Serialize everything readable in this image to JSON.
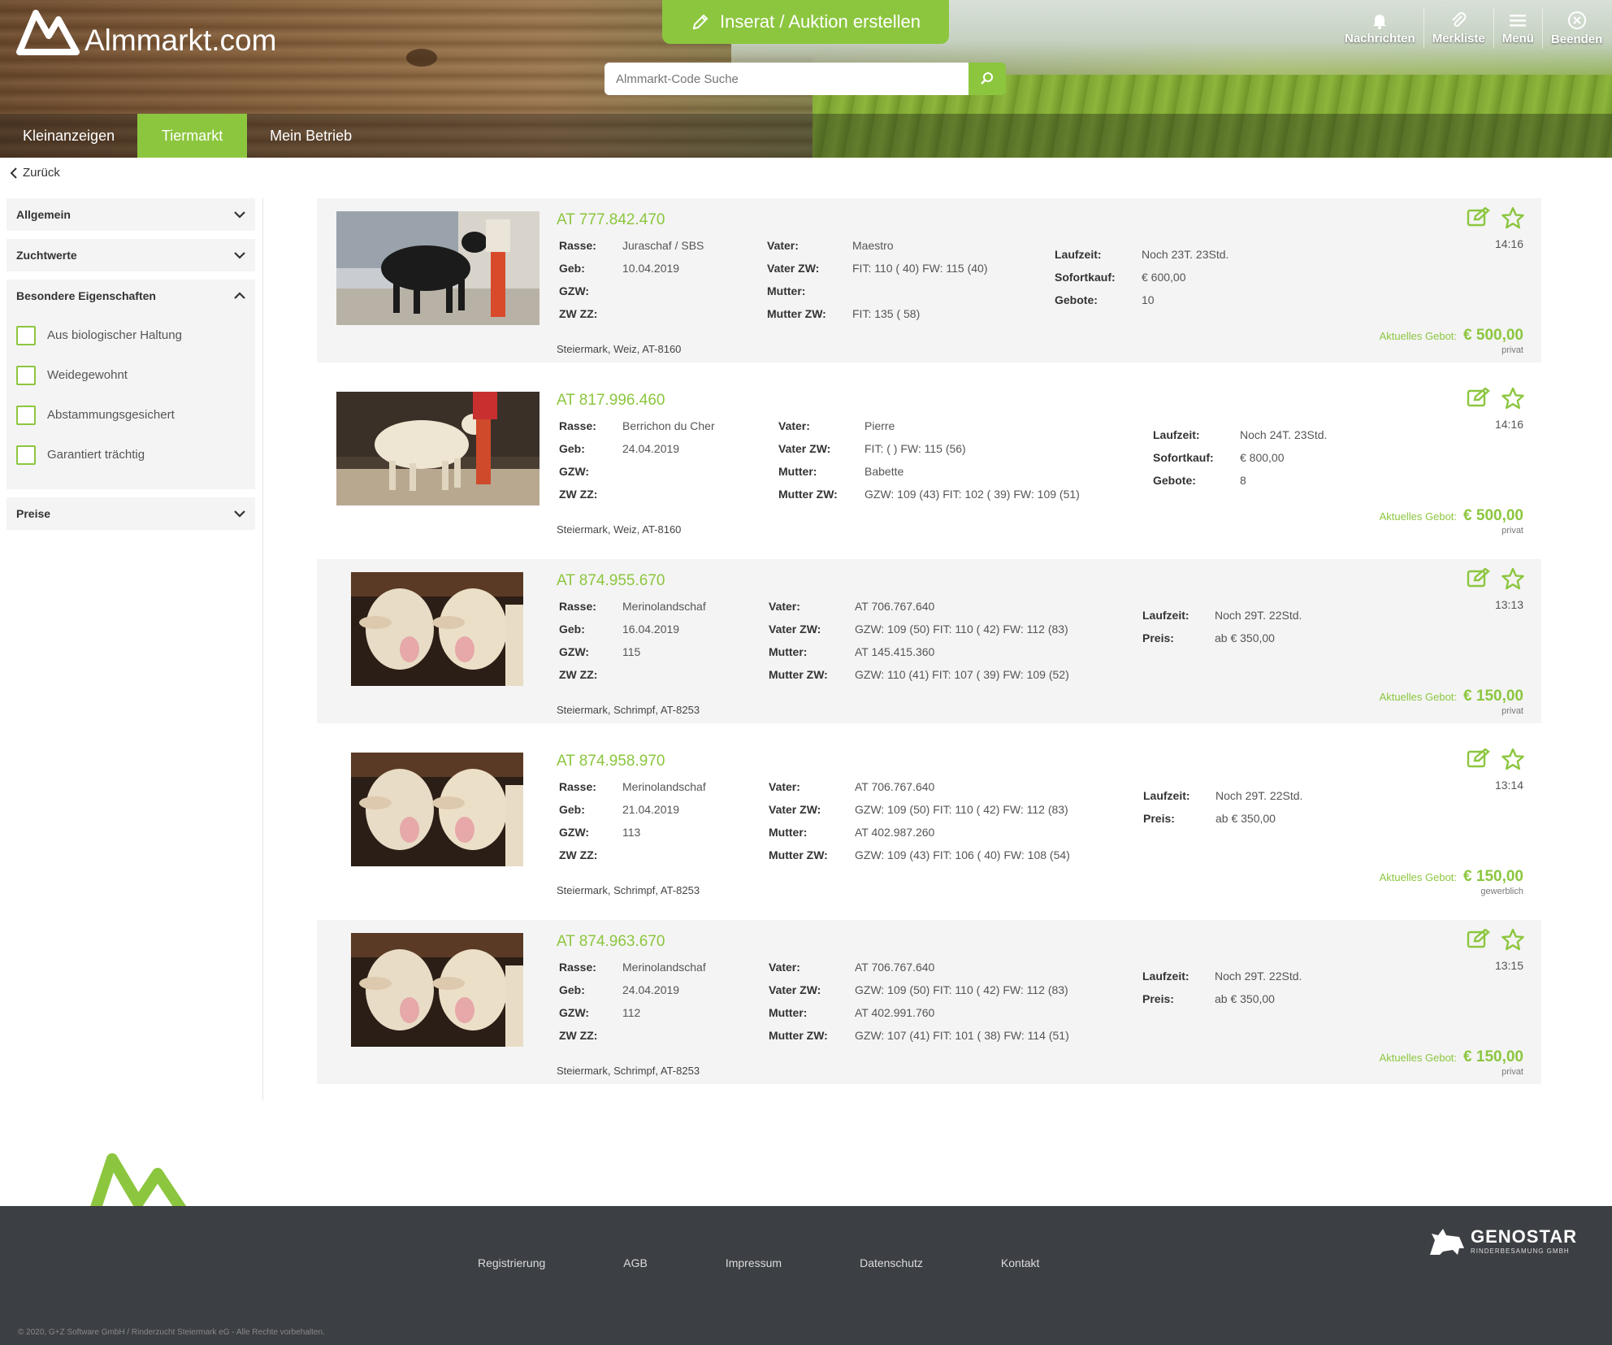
{
  "app": {
    "logo_text": "Almmarkt.com",
    "create_label": "Inserat / Auktion erstellen",
    "search_placeholder": "Almmarkt-Code Suche"
  },
  "topnav": [
    {
      "label": "Nachrichten",
      "icon": "bell-icon"
    },
    {
      "label": "Merkliste",
      "icon": "paperclip-icon"
    },
    {
      "label": "Menü",
      "icon": "menu-icon"
    },
    {
      "label": "Beenden",
      "icon": "close-circle-icon"
    }
  ],
  "tabs": [
    {
      "label": "Kleinanzeigen",
      "active": false
    },
    {
      "label": "Tiermarkt",
      "active": true
    },
    {
      "label": "Mein Betrieb",
      "active": false
    }
  ],
  "back_label": "Zurück",
  "sidebar": {
    "sections": [
      {
        "label": "Allgemein",
        "expanded": false
      },
      {
        "label": "Zuchtwerte",
        "expanded": false
      },
      {
        "label": "Besondere Eigenschaften",
        "expanded": true,
        "options": [
          "Aus biologischer Haltung",
          "Weidegewohnt",
          "Abstammungsgesichert",
          "Garantiert trächtig"
        ]
      },
      {
        "label": "Preise",
        "expanded": false
      }
    ]
  },
  "listings": [
    {
      "id": "AT 777.842.470",
      "rasse": "Juraschaf / SBS",
      "geb": "10.04.2019",
      "gzw": "",
      "zwzz": "",
      "vater": "Maestro",
      "vater_zw": "FIT: 110 ( 40) FW: 115 (40)",
      "mutter": "",
      "mutter_zw": "FIT: 135 ( 58)",
      "terms": [
        {
          "k": "Laufzeit:",
          "v": "Noch 23T. 23Std."
        },
        {
          "k": "Sofortkauf:",
          "v": "€ 600,00"
        },
        {
          "k": "Gebote:",
          "v": "10"
        }
      ],
      "location": "Steiermark, Weiz, AT-8160",
      "time": "14:16",
      "bid_label": "Aktuelles Gebot:",
      "bid": "€ 500,00",
      "seller": "privat"
    },
    {
      "id": "AT 817.996.460",
      "rasse": "Berrichon du Cher",
      "geb": "24.04.2019",
      "gzw": "",
      "zwzz": "",
      "vater": "Pierre",
      "vater_zw": "FIT: ( ) FW: 115 (56)",
      "mutter": "Babette",
      "mutter_zw": "GZW: 109 (43) FIT: 102 ( 39) FW: 109 (51)",
      "terms": [
        {
          "k": "Laufzeit:",
          "v": "Noch 24T. 23Std."
        },
        {
          "k": "Sofortkauf:",
          "v": "€ 800,00"
        },
        {
          "k": "Gebote:",
          "v": "8"
        }
      ],
      "location": "Steiermark, Weiz, AT-8160",
      "time": "14:16",
      "bid_label": "Aktuelles Gebot:",
      "bid": "€ 500,00",
      "seller": "privat"
    },
    {
      "id": "AT 874.955.670",
      "rasse": "Merinolandschaf",
      "geb": "16.04.2019",
      "gzw": "115",
      "zwzz": "",
      "vater": "AT 706.767.640",
      "vater_zw": "GZW: 109 (50) FIT: 110 ( 42) FW: 112 (83)",
      "mutter": "AT 145.415.360",
      "mutter_zw": "GZW: 110 (41) FIT: 107 ( 39) FW: 109 (52)",
      "terms": [
        {
          "k": "Laufzeit:",
          "v": "Noch 29T. 22Std."
        },
        {
          "k": "Preis:",
          "v": "ab € 350,00"
        }
      ],
      "location": "Steiermark, Schrimpf, AT-8253",
      "time": "13:13",
      "bid_label": "Aktuelles Gebot:",
      "bid": "€ 150,00",
      "seller": "privat"
    },
    {
      "id": "AT 874.958.970",
      "rasse": "Merinolandschaf",
      "geb": "21.04.2019",
      "gzw": "113",
      "zwzz": "",
      "vater": "AT 706.767.640",
      "vater_zw": "GZW: 109 (50) FIT: 110 ( 42) FW: 112 (83)",
      "mutter": "AT 402.987.260",
      "mutter_zw": "GZW: 109 (43) FIT: 106 ( 40) FW: 108 (54)",
      "terms": [
        {
          "k": "Laufzeit:",
          "v": "Noch 29T. 22Std."
        },
        {
          "k": "Preis:",
          "v": "ab € 350,00"
        }
      ],
      "location": "Steiermark, Schrimpf, AT-8253",
      "time": "13:14",
      "bid_label": "Aktuelles Gebot:",
      "bid": "€ 150,00",
      "seller": "gewerblich"
    },
    {
      "id": "AT 874.963.670",
      "rasse": "Merinolandschaf",
      "geb": "24.04.2019",
      "gzw": "112",
      "zwzz": "",
      "vater": "AT 706.767.640",
      "vater_zw": "GZW: 109 (50) FIT: 110 ( 42) FW: 112 (83)",
      "mutter": "AT 402.991.760",
      "mutter_zw": "GZW: 107 (41) FIT: 101 ( 38) FW: 114 (51)",
      "terms": [
        {
          "k": "Laufzeit:",
          "v": "Noch 29T. 22Std."
        },
        {
          "k": "Preis:",
          "v": "ab € 350,00"
        }
      ],
      "location": "Steiermark, Schrimpf, AT-8253",
      "time": "13:15",
      "bid_label": "Aktuelles Gebot:",
      "bid": "€ 150,00",
      "seller": "privat"
    }
  ],
  "labels": {
    "rasse": "Rasse:",
    "geb": "Geb:",
    "gzw": "GZW:",
    "zwzz": "ZW ZZ:",
    "vater": "Vater:",
    "vater_zw": "Vater ZW:",
    "mutter": "Mutter:",
    "mutter_zw": "Mutter ZW:"
  },
  "footer": {
    "links": [
      "Registrierung",
      "AGB",
      "Impressum",
      "Datenschutz",
      "Kontakt"
    ],
    "partner_name": "GENOSTAR",
    "partner_sub": "RINDERBESAMUNG GMBH",
    "copyright": "© 2020, G+Z Software GmbH / Rinderzucht Steiermark eG - Alle Rechte vorbehalten."
  },
  "colors": {
    "accent": "#8cc63f",
    "footer_bg": "#3c3f44",
    "panel_bg": "#f4f4f4"
  }
}
